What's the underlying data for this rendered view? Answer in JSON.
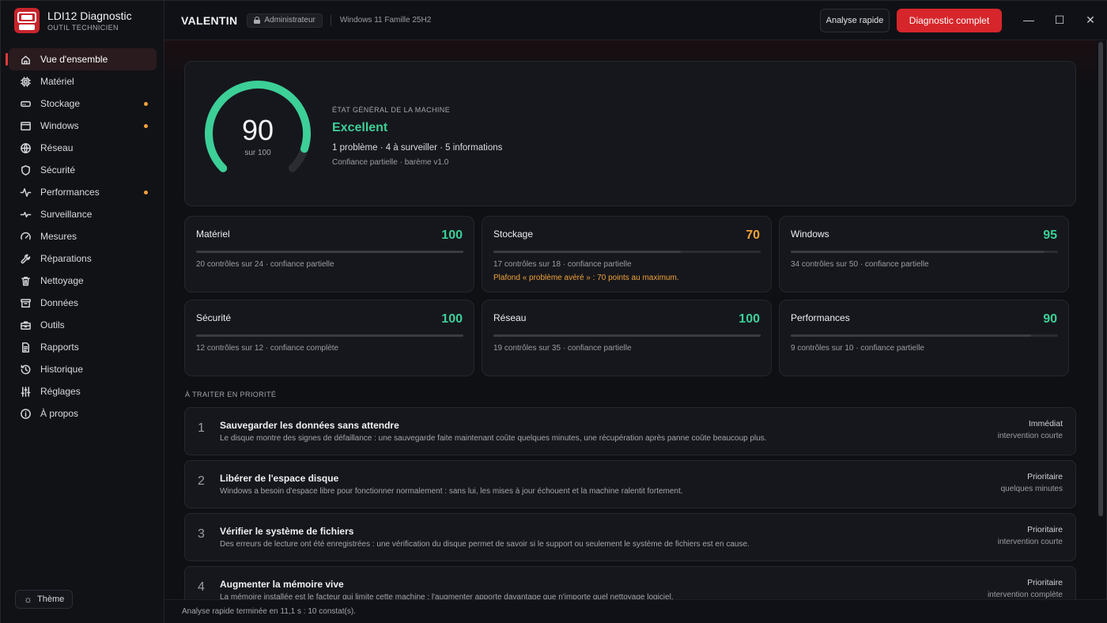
{
  "app": {
    "title": "LDI12 Diagnostic",
    "subtitle": "OUTIL TECHNICIEN"
  },
  "header": {
    "machine": "VALENTIN",
    "role": "Administrateur",
    "os": "Windows 11 Famille 25H2",
    "quick_label": "Analyse rapide",
    "full_label": "Diagnostic complet",
    "minimize": "—",
    "maximize": "☐",
    "close": "✕"
  },
  "colors": {
    "accent": "#d6262b",
    "good": "#3ccf97",
    "warn": "#f0a23a"
  },
  "sidebar": {
    "items": [
      {
        "label": "Vue d'ensemble",
        "icon": "home-icon",
        "active": true,
        "dot": false
      },
      {
        "label": "Matériel",
        "icon": "chip-icon",
        "active": false,
        "dot": false
      },
      {
        "label": "Stockage",
        "icon": "drive-icon",
        "active": false,
        "dot": true
      },
      {
        "label": "Windows",
        "icon": "window-icon",
        "active": false,
        "dot": true
      },
      {
        "label": "Réseau",
        "icon": "globe-icon",
        "active": false,
        "dot": false
      },
      {
        "label": "Sécurité",
        "icon": "shield-icon",
        "active": false,
        "dot": false
      },
      {
        "label": "Performances",
        "icon": "activity-icon",
        "active": false,
        "dot": true
      },
      {
        "label": "Surveillance",
        "icon": "pulse-icon",
        "active": false,
        "dot": false
      },
      {
        "label": "Mesures",
        "icon": "gauge-icon",
        "active": false,
        "dot": false
      },
      {
        "label": "Réparations",
        "icon": "wrench-icon",
        "active": false,
        "dot": false
      },
      {
        "label": "Nettoyage",
        "icon": "trash-icon",
        "active": false,
        "dot": false
      },
      {
        "label": "Données",
        "icon": "archive-icon",
        "active": false,
        "dot": false
      },
      {
        "label": "Outils",
        "icon": "toolbox-icon",
        "active": false,
        "dot": false
      },
      {
        "label": "Rapports",
        "icon": "file-icon",
        "active": false,
        "dot": false
      },
      {
        "label": "Historique",
        "icon": "history-icon",
        "active": false,
        "dot": false
      },
      {
        "label": "Réglages",
        "icon": "sliders-icon",
        "active": false,
        "dot": false
      },
      {
        "label": "À propos",
        "icon": "info-icon",
        "active": false,
        "dot": false
      }
    ],
    "theme_label": "Thème"
  },
  "hero": {
    "score": "90",
    "score_value": 90,
    "score_max": 100,
    "score_sub": "sur 100",
    "label": "ÉTAT GÉNÉRAL DE LA MACHINE",
    "status": "Excellent",
    "summary": "1 problème · 4 à surveiller · 5 informations",
    "confidence": "Confiance partielle · barème v1.0"
  },
  "cards": [
    {
      "name": "Matériel",
      "score": "100",
      "value": 100,
      "tone": "green",
      "info": "20 contrôles sur 24 · confiance partielle",
      "warn": ""
    },
    {
      "name": "Stockage",
      "score": "70",
      "value": 70,
      "tone": "orange",
      "info": "17 contrôles sur 18 · confiance partielle",
      "warn": "Plafond « problème avéré » : 70 points au maximum."
    },
    {
      "name": "Windows",
      "score": "95",
      "value": 95,
      "tone": "green",
      "info": "34 contrôles sur 50 · confiance partielle",
      "warn": ""
    },
    {
      "name": "Sécurité",
      "score": "100",
      "value": 100,
      "tone": "green",
      "info": "12 contrôles sur 12 · confiance complète",
      "warn": ""
    },
    {
      "name": "Réseau",
      "score": "100",
      "value": 100,
      "tone": "green",
      "info": "19 contrôles sur 35 · confiance partielle",
      "warn": ""
    },
    {
      "name": "Performances",
      "score": "90",
      "value": 90,
      "tone": "green",
      "info": "9 contrôles sur 10 · confiance partielle",
      "warn": ""
    }
  ],
  "priorities": {
    "title": "À TRAITER EN PRIORITÉ",
    "items": [
      {
        "num": "1",
        "title": "Sauvegarder les données sans attendre",
        "desc": "Le disque montre des signes de défaillance : une sauvegarde faite maintenant coûte quelques minutes, une récupération après panne coûte beaucoup plus.",
        "level": "Immédiat",
        "duration": "intervention courte"
      },
      {
        "num": "2",
        "title": "Libérer de l'espace disque",
        "desc": "Windows a besoin d'espace libre pour fonctionner normalement : sans lui, les mises à jour échouent et la machine ralentit fortement.",
        "level": "Prioritaire",
        "duration": "quelques minutes"
      },
      {
        "num": "3",
        "title": "Vérifier le système de fichiers",
        "desc": "Des erreurs de lecture ont été enregistrées : une vérification du disque permet de savoir si le support ou seulement le système de fichiers est en cause.",
        "level": "Prioritaire",
        "duration": "intervention courte"
      },
      {
        "num": "4",
        "title": "Augmenter la mémoire vive",
        "desc": "La mémoire installée est le facteur qui limite cette machine : l'augmenter apporte davantage que n'importe quel nettoyage logiciel.",
        "level": "Prioritaire",
        "duration": "intervention complète"
      }
    ]
  },
  "statusbar": {
    "text": "Analyse rapide terminée en 11,1 s : 10 constat(s)."
  }
}
